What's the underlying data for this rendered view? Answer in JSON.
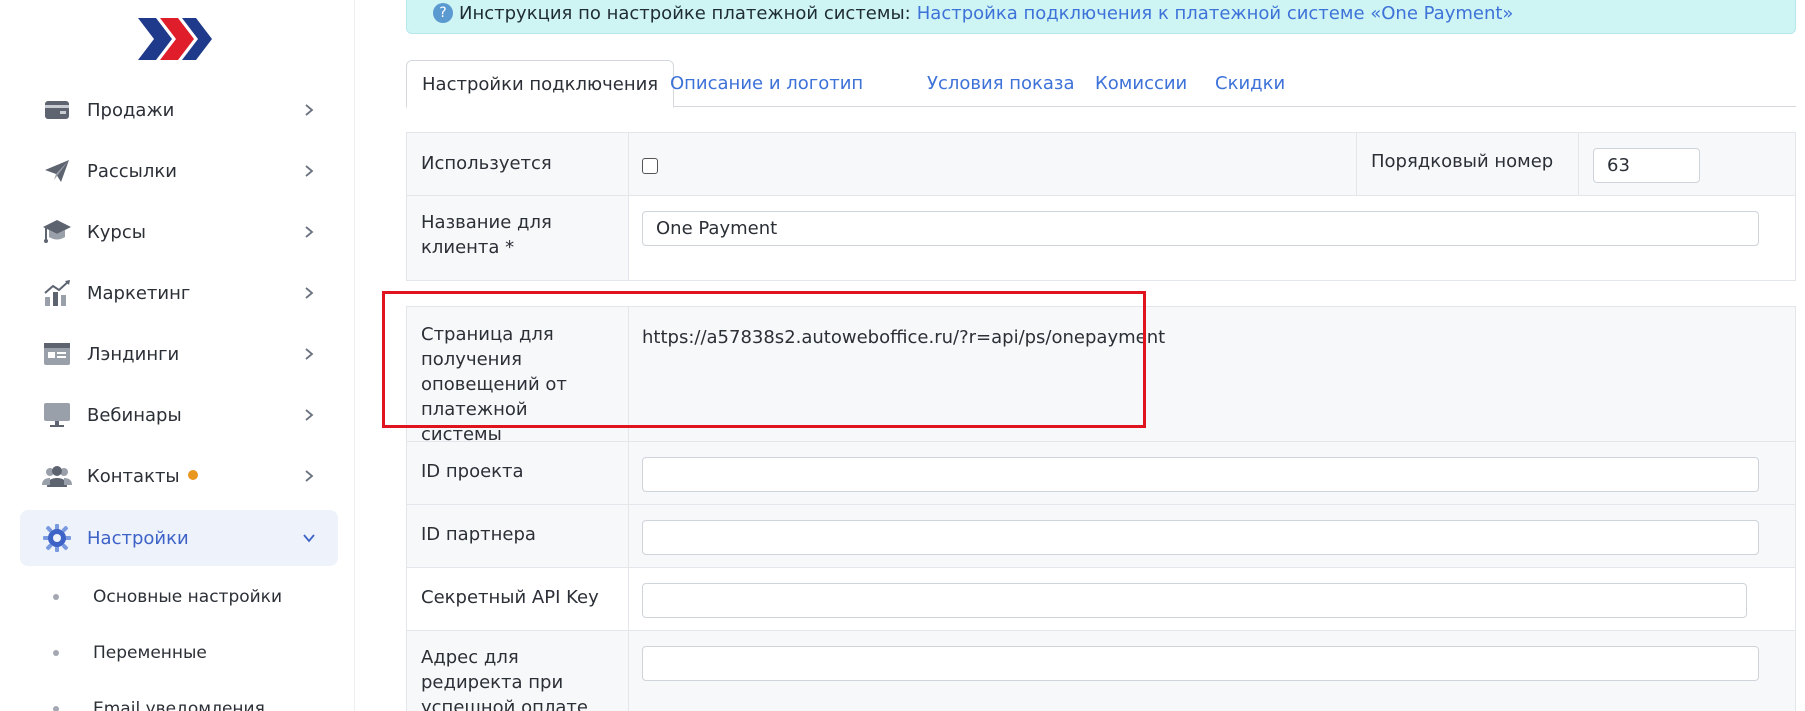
{
  "sidebar": {
    "items": [
      {
        "label": "Продажи",
        "icon": "wallet-icon"
      },
      {
        "label": "Рассылки",
        "icon": "paper-plane-icon"
      },
      {
        "label": "Курсы",
        "icon": "graduation-cap-icon"
      },
      {
        "label": "Маркетинг",
        "icon": "chart-growth-icon"
      },
      {
        "label": "Лэндинги",
        "icon": "landing-page-icon"
      },
      {
        "label": "Вебинары",
        "icon": "monitor-icon"
      },
      {
        "label": "Контакты",
        "icon": "users-icon"
      },
      {
        "label": "Настройки",
        "icon": "gear-icon",
        "active": true
      }
    ],
    "sub_items": [
      {
        "label": "Основные настройки"
      },
      {
        "label": "Переменные"
      },
      {
        "label": "Email уведомления"
      }
    ]
  },
  "banner": {
    "text": "Инструкция по настройке платежной системы:",
    "link": "Настройка подключения к платежной системе «One Payment»"
  },
  "tabs": [
    {
      "label": "Настройки подключения",
      "active": true
    },
    {
      "label": "Описание и логотип"
    },
    {
      "label": "Условия показа"
    },
    {
      "label": "Комиссии"
    },
    {
      "label": "Скидки"
    }
  ],
  "form": {
    "used_label": "Используется",
    "order_label": "Порядковый номер",
    "order_value": "63",
    "client_name_label": "Название для клиента *",
    "client_name_value": "One Payment",
    "notify_page_label": "Страница для получения оповещений от платежной системы",
    "notify_page_value": "https://a57838s2.autoweboffice.ru/?r=api/ps/onepayment",
    "project_id_label": "ID проекта",
    "partner_id_label": "ID партнера",
    "api_key_label": "Секретный API Key",
    "redirect_label": "Адрес для редиректа при успешной оплате"
  },
  "colors": {
    "accent": "#3d72d8",
    "banner_bg": "#cff4f4",
    "highlight": "#e0141e",
    "badge": "#e8961e"
  }
}
